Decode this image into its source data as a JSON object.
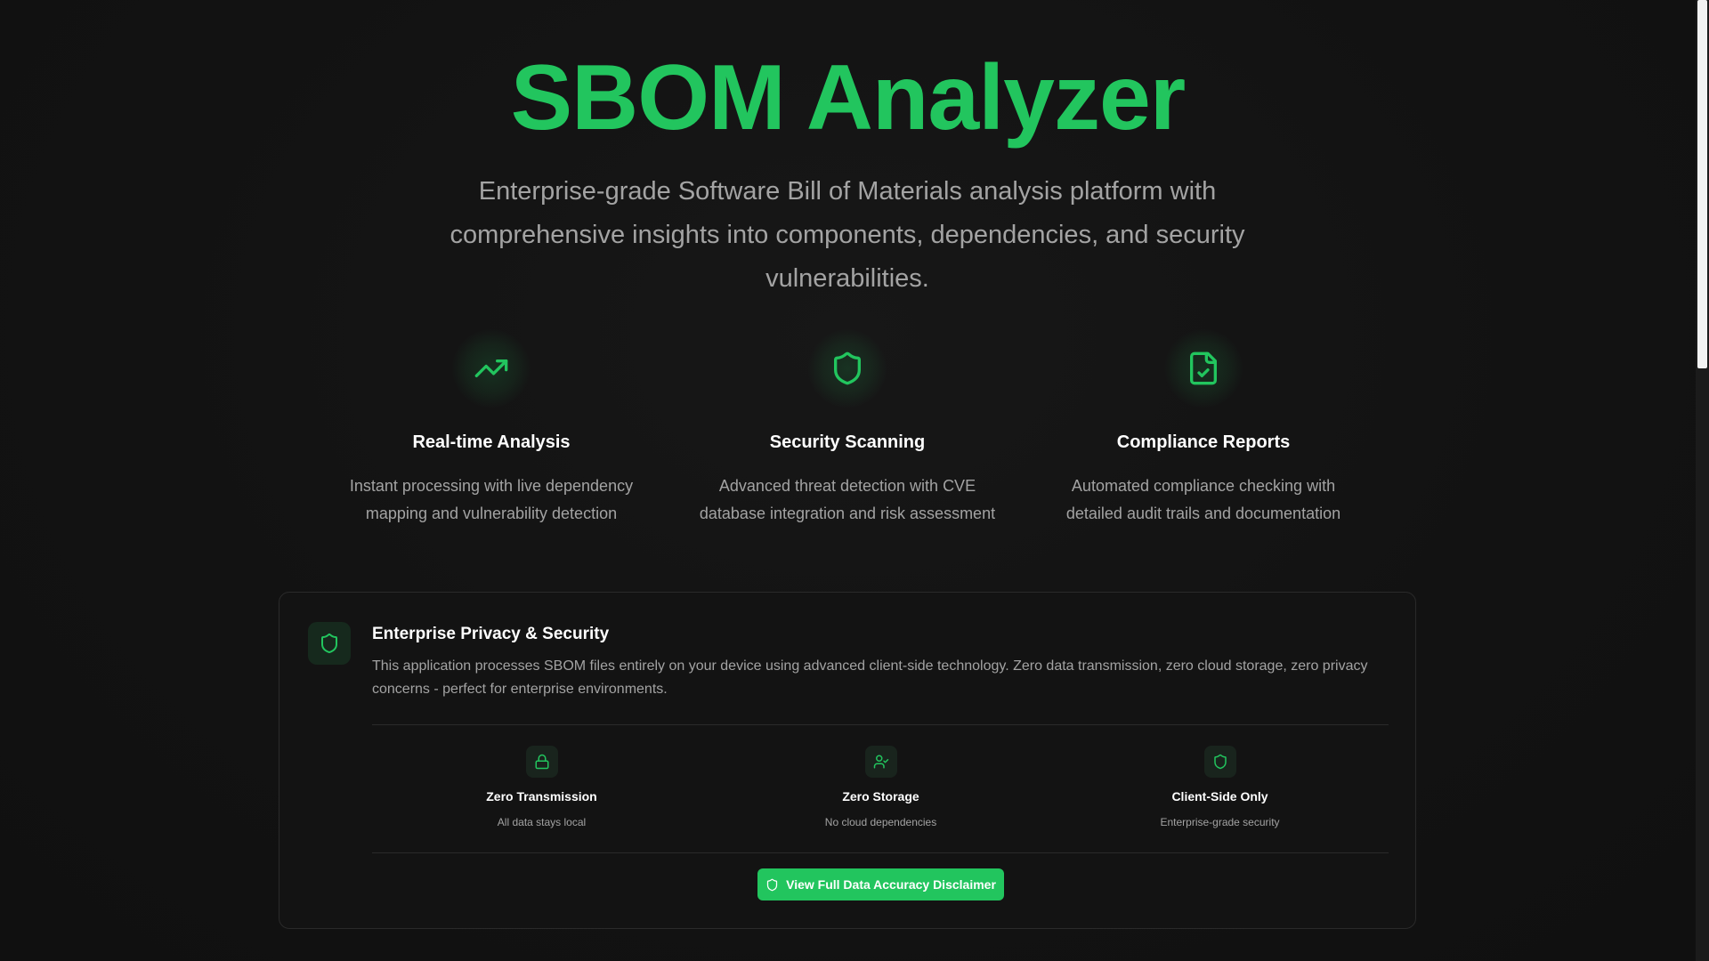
{
  "hero": {
    "title": "SBOM Analyzer",
    "subtitle": "Enterprise-grade Software Bill of Materials analysis platform with comprehensive insights into components, dependencies, and security vulnerabilities."
  },
  "features": [
    {
      "icon": "trending-up-icon",
      "title": "Real-time Analysis",
      "description": "Instant processing with live dependency mapping and vulnerability detection"
    },
    {
      "icon": "shield-icon",
      "title": "Security Scanning",
      "description": "Advanced threat detection with CVE database integration and risk assessment"
    },
    {
      "icon": "file-check-icon",
      "title": "Compliance Reports",
      "description": "Automated compliance checking with detailed audit trails and documentation"
    }
  ],
  "privacy": {
    "icon": "shield-icon",
    "title": "Enterprise Privacy & Security",
    "description": "This application processes SBOM files entirely on your device using advanced client-side technology. Zero data transmission, zero cloud storage, zero privacy concerns - perfect for enterprise environments.",
    "badges": [
      {
        "icon": "lock-icon",
        "title": "Zero Transmission",
        "description": "All data stays local"
      },
      {
        "icon": "user-check-icon",
        "title": "Zero Storage",
        "description": "No cloud dependencies"
      },
      {
        "icon": "shield-icon",
        "title": "Client-Side Only",
        "description": "Enterprise-grade security"
      }
    ],
    "button_label": "View Full Data Accuracy Disclaimer",
    "button_icon": "shield-icon"
  },
  "colors": {
    "accent": "#22c55e",
    "background": "#121212",
    "text_primary": "#ffffff",
    "text_secondary": "#a3a3a3"
  }
}
